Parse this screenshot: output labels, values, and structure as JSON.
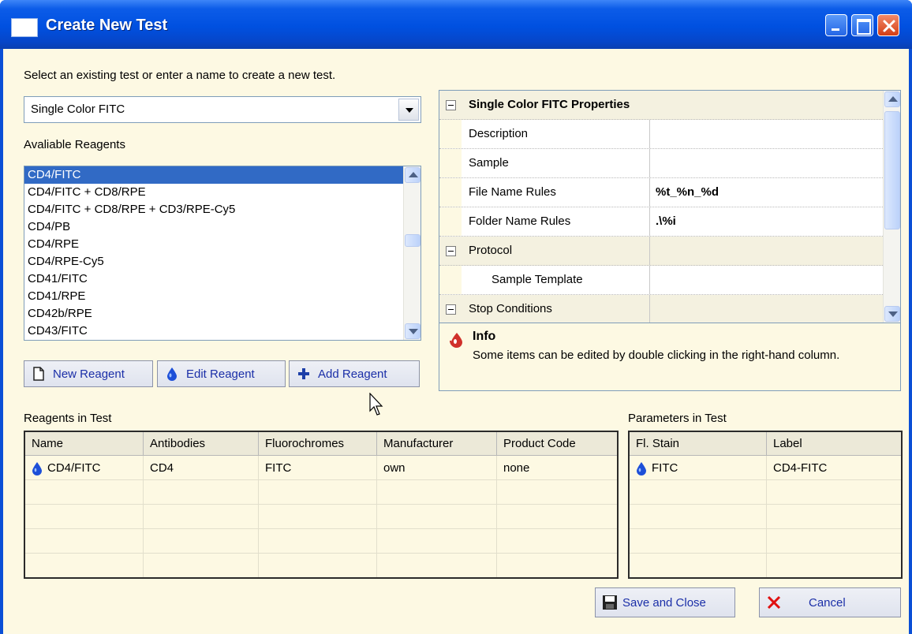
{
  "window": {
    "title": "Create New Test"
  },
  "prompt": "Select an existing test or enter a name to create a new test.",
  "test_combo": {
    "value": "Single Color FITC"
  },
  "available_label": "Avaliable Reagents",
  "available_reagents": [
    "CD4/FITC",
    "CD4/FITC + CD8/RPE",
    "CD4/FITC + CD8/RPE + CD3/RPE-Cy5",
    "CD4/PB",
    "CD4/RPE",
    "CD4/RPE-Cy5",
    "CD41/FITC",
    "CD41/RPE",
    "CD42b/RPE",
    "CD43/FITC"
  ],
  "selected_reagent": "CD4/FITC",
  "reagent_buttons": {
    "new": "New Reagent",
    "edit": "Edit Reagent",
    "add": "Add Reagent"
  },
  "properties": {
    "header": "Single Color FITC Properties",
    "rows": {
      "description": {
        "name": "Description",
        "value": ""
      },
      "sample": {
        "name": "Sample",
        "value": ""
      },
      "file_name_rules": {
        "name": "File Name Rules",
        "value": "%t_%n_%d"
      },
      "folder_name_rules": {
        "name": "Folder Name Rules",
        "value": ".\\%i"
      },
      "protocol": {
        "name": "Protocol",
        "value": ""
      },
      "sample_template": {
        "name": "Sample Template",
        "value": ""
      },
      "stop_conditions": {
        "name": "Stop Conditions",
        "value": ""
      }
    }
  },
  "info": {
    "title": "Info",
    "text": "Some items can be edited by double clicking in the right-hand column."
  },
  "reagents_in_test": {
    "label": "Reagents in Test",
    "columns": [
      "Name",
      "Antibodies",
      "Fluorochromes",
      "Manufacturer",
      "Product Code"
    ],
    "rows": [
      {
        "name": "CD4/FITC",
        "antibodies": "CD4",
        "fluorochromes": "FITC",
        "manufacturer": "own",
        "product_code": "none"
      }
    ]
  },
  "parameters_in_test": {
    "label": "Parameters in Test",
    "columns": [
      "Fl. Stain",
      "Label"
    ],
    "rows": [
      {
        "stain": "FITC",
        "label": "CD4-FITC"
      }
    ]
  },
  "footer": {
    "save": "Save and Close",
    "cancel": "Cancel"
  },
  "colors": {
    "selection": "#316ac5",
    "client_bg": "#fdf9e3",
    "titlebar": "#0050e0",
    "reagent_drop": "#1d4fd8",
    "info_icon": "#d0302a"
  }
}
